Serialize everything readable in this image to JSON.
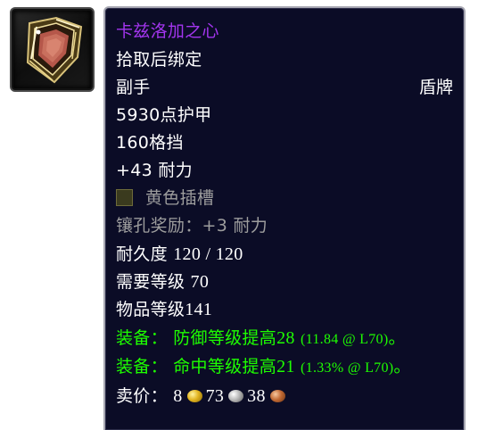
{
  "item": {
    "name": "卡兹洛加之心",
    "binding": "拾取后绑定",
    "slot": "副手",
    "type": "盾牌",
    "armor": "5930点护甲",
    "block": "160格挡",
    "stamina": "+43 耐力",
    "socket": {
      "label": "黄色插槽",
      "icon": "yellow-socket-icon"
    },
    "socket_bonus": "镶孔奖励：+3 耐力",
    "durability_label": "耐久度",
    "durability_value": "120 / 120",
    "required_level_label": "需要等级",
    "required_level": "70",
    "item_level_label": "物品等级",
    "item_level": "141",
    "equip_effects": [
      {
        "prefix": "装备：",
        "text": "防御等级提高",
        "value": "28",
        "detail": "(11.84 @ L70)",
        "suffix": "。"
      },
      {
        "prefix": "装备：",
        "text": "命中等级提高",
        "value": "21",
        "detail": "(1.33% @ L70)",
        "suffix": "。"
      }
    ],
    "sell_price": {
      "label": "卖价：",
      "gold": "8",
      "silver": "73",
      "copper": "38"
    },
    "icon": "shield-icon"
  },
  "colors": {
    "epic": "#a335ee",
    "white": "#ffffff",
    "gray": "#9d9d9d",
    "green": "#1eff00",
    "background": "#0b0c26",
    "border": "#a7a7b2"
  }
}
